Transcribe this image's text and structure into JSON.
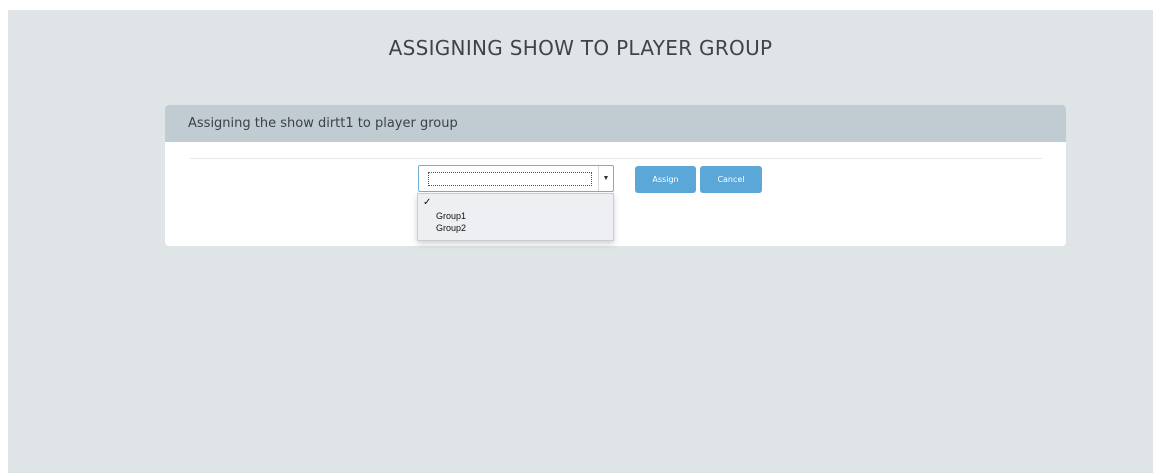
{
  "page": {
    "title": "ASSIGNING SHOW TO PLAYER GROUP"
  },
  "panel": {
    "header": "Assigning the show dirtt1 to player group"
  },
  "group_select": {
    "selected_value": "",
    "options": [
      {
        "label": "",
        "selected": true,
        "check_mark": "✓"
      },
      {
        "label": "Group1",
        "selected": false
      },
      {
        "label": "Group2",
        "selected": false
      }
    ],
    "arrow_glyph": "▼"
  },
  "buttons": {
    "assign_label": "Assign",
    "cancel_label": "Cancel"
  },
  "colors": {
    "background": "#dfe5e6",
    "panel_header": "#c0ccd2",
    "button": "#5aa7d8",
    "select_border": "#6fb1dc"
  }
}
